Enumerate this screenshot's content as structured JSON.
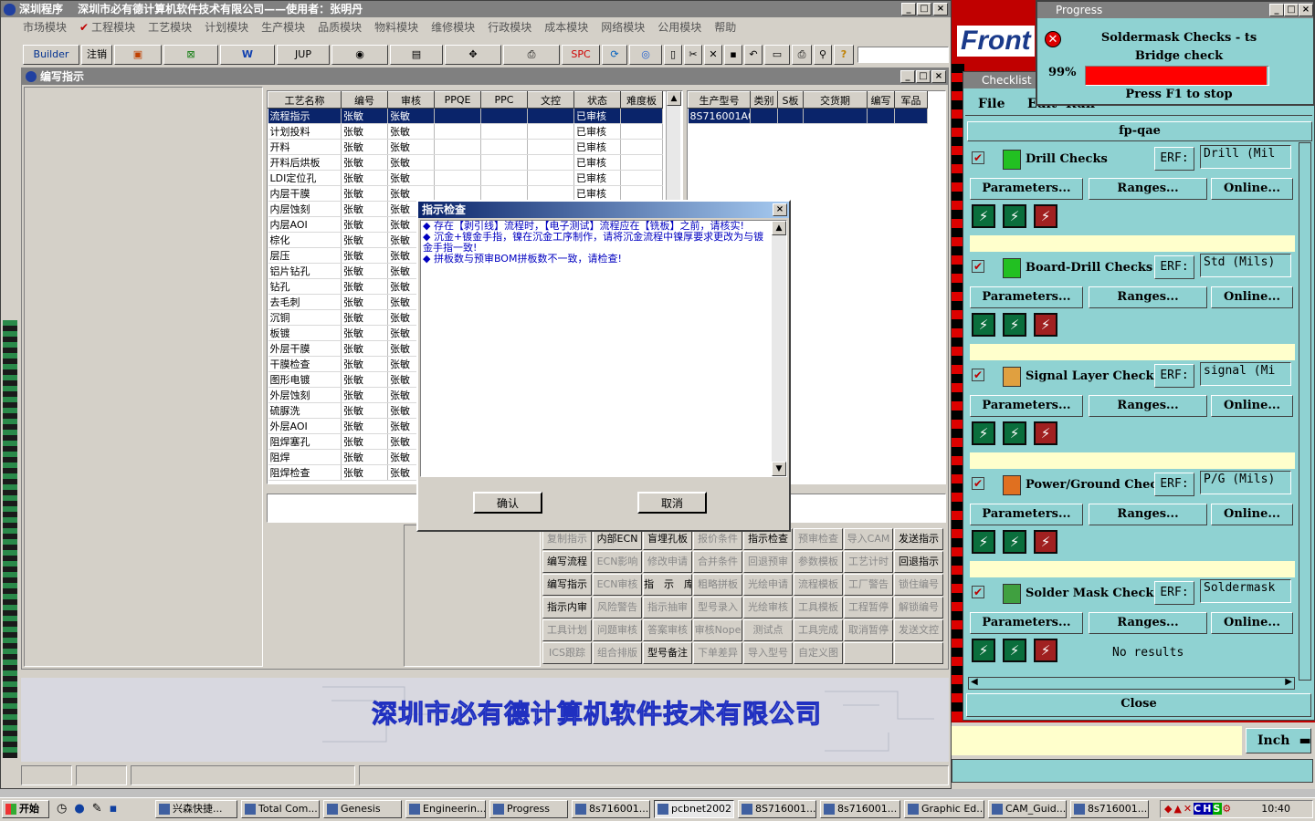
{
  "main_window": {
    "title": "深圳程序　 深圳市必有德计算机软件技术有限公司——使用者：张明丹",
    "menu": [
      "市场模块",
      "工程模块",
      "工艺模块",
      "计划模块",
      "生产模块",
      "品质模块",
      "物料模块",
      "维修模块",
      "行政模块",
      "成本模块",
      "网络模块",
      "公用模块",
      "帮助"
    ],
    "toolbar": {
      "builder": "Builder",
      "logout": "注销",
      "jup": "JUP",
      "spc": "SPC"
    }
  },
  "sub_window": {
    "title": "编写指示"
  },
  "process_table": {
    "headers": [
      "工艺名称",
      "编号",
      "审核",
      "PPQE",
      "PPC",
      "文控",
      "状态",
      "难度板"
    ],
    "rows": [
      [
        "流程指示",
        "张敏",
        "张敏",
        "",
        "",
        "",
        "已审核",
        ""
      ],
      [
        "计划投料",
        "张敏",
        "张敏",
        "",
        "",
        "",
        "已审核",
        ""
      ],
      [
        "开料",
        "张敏",
        "张敏",
        "",
        "",
        "",
        "已审核",
        ""
      ],
      [
        "开料后烘板",
        "张敏",
        "张敏",
        "",
        "",
        "",
        "已审核",
        ""
      ],
      [
        "LDI定位孔",
        "张敏",
        "张敏",
        "",
        "",
        "",
        "已审核",
        ""
      ],
      [
        "内层干膜",
        "张敏",
        "张敏",
        "",
        "",
        "",
        "已审核",
        ""
      ],
      [
        "内层蚀刻",
        "张敏",
        "张敏",
        "",
        "",
        "",
        "",
        ""
      ],
      [
        "内层AOI",
        "张敏",
        "张敏",
        "",
        "",
        "",
        "",
        ""
      ],
      [
        "棕化",
        "张敏",
        "张敏",
        "",
        "",
        "",
        "",
        ""
      ],
      [
        "层压",
        "张敏",
        "张敏",
        "",
        "",
        "",
        "",
        ""
      ],
      [
        "铝片钻孔",
        "张敏",
        "张敏",
        "",
        "",
        "",
        "",
        ""
      ],
      [
        "钻孔",
        "张敏",
        "张敏",
        "",
        "",
        "",
        "",
        ""
      ],
      [
        "去毛刺",
        "张敏",
        "张敏",
        "",
        "",
        "",
        "",
        ""
      ],
      [
        "沉铜",
        "张敏",
        "张敏",
        "",
        "",
        "",
        "",
        ""
      ],
      [
        "板镀",
        "张敏",
        "张敏",
        "",
        "",
        "",
        "",
        ""
      ],
      [
        "外层干膜",
        "张敏",
        "张敏",
        "",
        "",
        "",
        "",
        ""
      ],
      [
        "干膜检查",
        "张敏",
        "张敏",
        "",
        "",
        "",
        "",
        ""
      ],
      [
        "图形电镀",
        "张敏",
        "张敏",
        "",
        "",
        "",
        "",
        ""
      ],
      [
        "外层蚀刻",
        "张敏",
        "张敏",
        "",
        "",
        "",
        "",
        ""
      ],
      [
        "硫脲洗",
        "张敏",
        "张敏",
        "",
        "",
        "",
        "",
        ""
      ],
      [
        "外层AOI",
        "张敏",
        "张敏",
        "",
        "",
        "",
        "",
        ""
      ],
      [
        "阻焊塞孔",
        "张敏",
        "张敏",
        "",
        "",
        "",
        "",
        ""
      ],
      [
        "阻焊",
        "张敏",
        "张敏",
        "",
        "",
        "",
        "",
        ""
      ],
      [
        "阻焊检查",
        "张敏",
        "张敏",
        "",
        "",
        "",
        "",
        ""
      ]
    ]
  },
  "order_table": {
    "headers": [
      "生产型号",
      "类别",
      "S板",
      "交货期",
      "编写",
      "军品"
    ],
    "rows": [
      [
        "8S716001A0",
        "",
        "",
        "",
        "",
        ""
      ]
    ]
  },
  "action_buttons": [
    [
      "复制指示",
      "内部ECN",
      "盲埋孔板",
      "报价条件",
      "指示检查",
      "预审检查",
      "导入CAM",
      "发送指示"
    ],
    [
      "编写流程",
      "ECN影响",
      "修改申请",
      "合并条件",
      "回退预审",
      "参数模板",
      "工艺计时",
      "回退指示"
    ],
    [
      "编写指示",
      "ECN审核",
      "指　示　库",
      "粗略拼板",
      "光绘申请",
      "流程模板",
      "工厂警告",
      "锁住编号"
    ],
    [
      "指示内审",
      "风险警告",
      "指示抽审",
      "型号录入",
      "光绘审核",
      "工具模板",
      "工程暂停",
      "解锁编号"
    ],
    [
      "工具计划",
      "问题审核",
      "答案审核",
      "审核Nope",
      "测试点",
      "工具完成",
      "取消暂停",
      "发送文控"
    ],
    [
      "ICS跟踪",
      "组合排版",
      "型号备注",
      "下单差异",
      "导入型号",
      "自定义图",
      "",
      ""
    ]
  ],
  "action_enabled": [
    [
      false,
      true,
      true,
      false,
      true,
      false,
      false,
      true
    ],
    [
      true,
      false,
      false,
      false,
      false,
      false,
      false,
      true
    ],
    [
      true,
      false,
      true,
      false,
      false,
      false,
      false,
      false
    ],
    [
      true,
      false,
      false,
      false,
      false,
      false,
      false,
      false
    ],
    [
      false,
      false,
      false,
      false,
      false,
      false,
      false,
      false
    ],
    [
      false,
      false,
      true,
      false,
      false,
      false,
      false,
      false
    ]
  ],
  "footer_company": "深圳市必有德计算机软件技术有限公司",
  "dialog": {
    "title": "指示检查",
    "messages": [
      "◆ 存在【剥引线】流程时，【电子测试】流程应在【铣板】之前，请核实!",
      "◆ 沉金+镀金手指，镍在沉金工序制作，请将沉金流程中镍厚要求更改为与镀金手指一致!",
      "◆ 拼板数与预审BOM拼板数不一致，请检查!"
    ],
    "ok": "确认",
    "cancel": "取消"
  },
  "progress": {
    "title": "Progress",
    "line1": "Soldermask Checks - ts",
    "line2": "Bridge check",
    "percent": "99%",
    "value": 0.99,
    "hint": "Press F1 to stop",
    "bar_color": "#ff0000"
  },
  "frontline": {
    "logo": "Front"
  },
  "checklist": {
    "title": "Checklist",
    "menu": [
      "File",
      "Edit",
      "Run"
    ],
    "name": "fp-qae",
    "sections": [
      {
        "title": "Drill Checks",
        "erf": "ERF:",
        "field": "Drill (Mil",
        "status": ""
      },
      {
        "title": "Board-Drill Checks",
        "erf": "ERF:",
        "field": "Std (Mils)",
        "status": ""
      },
      {
        "title": "Signal Layer Checks",
        "erf": "ERF:",
        "field": "signal (Mi",
        "status": ""
      },
      {
        "title": "Power/Ground Checks",
        "erf": "ERF:",
        "field": "P/G (Mils)",
        "status": ""
      },
      {
        "title": "Solder Mask Checks",
        "erf": "ERF:",
        "field": "Soldermask",
        "status": "No results"
      }
    ],
    "buttons": [
      "Parameters...",
      "Ranges...",
      "Online..."
    ],
    "close": "Close"
  },
  "units": "Inch",
  "taskbar": {
    "start": "开始",
    "time": "10:40",
    "tasks": [
      "兴森快捷...",
      "Total Com...",
      "Genesis",
      "Engineerin...",
      "Progress",
      "8s716001...",
      "pcbnet2002",
      "8S716001...",
      "8s716001...",
      "Graphic Ed...",
      "CAM_Guid...",
      "8s716001..."
    ]
  }
}
